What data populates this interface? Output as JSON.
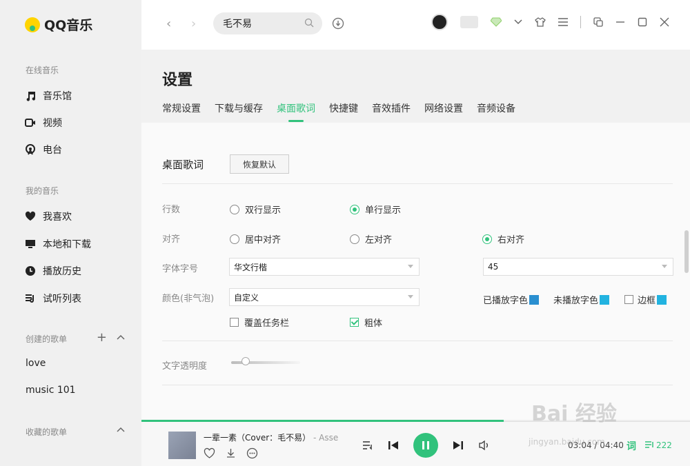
{
  "app": {
    "logo_text": "QQ音乐"
  },
  "sidebar": {
    "online_title": "在线音乐",
    "online_items": [
      {
        "label": "音乐馆",
        "icon": "music-note-icon"
      },
      {
        "label": "视频",
        "icon": "video-icon"
      },
      {
        "label": "电台",
        "icon": "radio-icon"
      }
    ],
    "my_title": "我的音乐",
    "my_items": [
      {
        "label": "我喜欢",
        "icon": "heart-icon"
      },
      {
        "label": "本地和下载",
        "icon": "monitor-icon"
      },
      {
        "label": "播放历史",
        "icon": "clock-icon"
      },
      {
        "label": "试听列表",
        "icon": "playlist-icon"
      }
    ],
    "created_title": "创建的歌单",
    "created_playlists": [
      "love",
      "music  101"
    ],
    "collected_title": "收藏的歌单"
  },
  "topbar": {
    "search_value": "毛不易"
  },
  "settings": {
    "title": "设置",
    "tabs": [
      "常规设置",
      "下载与缓存",
      "桌面歌词",
      "快捷键",
      "音效插件",
      "网络设置",
      "音频设备"
    ],
    "active_tab": "桌面歌词",
    "section_title": "桌面歌词",
    "restore_label": "恢复默认",
    "rows_label": "行数",
    "rows_options": [
      "双行显示",
      "单行显示"
    ],
    "rows_selected": "单行显示",
    "align_label": "对齐",
    "align_options": [
      "居中对齐",
      "左对齐",
      "右对齐"
    ],
    "align_selected": "右对齐",
    "font_label": "字体字号",
    "font_value": "华文行楷",
    "size_value": "45",
    "color_label": "颜色(非气泡)",
    "color_value": "自定义",
    "played_color_label": "已播放字色",
    "unplayed_color_label": "未播放字色",
    "border_label": "边框",
    "played_color": "#2a8fd0",
    "unplayed_color": "#22b3e0",
    "border_color": "#22b3e0",
    "cover_taskbar_label": "覆盖任务栏",
    "bold_label": "粗体",
    "cover_taskbar_checked": false,
    "bold_checked": true,
    "border_checked": false,
    "opacity_label": "文字透明度",
    "opacity_level": 0.15
  },
  "player": {
    "song_title": "一辈一素（Cover：毛不易）",
    "artist_trail": "- Asse",
    "elapsed": "03:04",
    "total": "04:40",
    "time_text": "03:04 / 04:40",
    "progress": 0.66,
    "lyric_label": "词",
    "playlist_count": "222"
  },
  "watermark": {
    "main": "Bai 经验",
    "sub": "jingyan.baidu.com"
  },
  "colors": {
    "accent": "#31c27c"
  }
}
